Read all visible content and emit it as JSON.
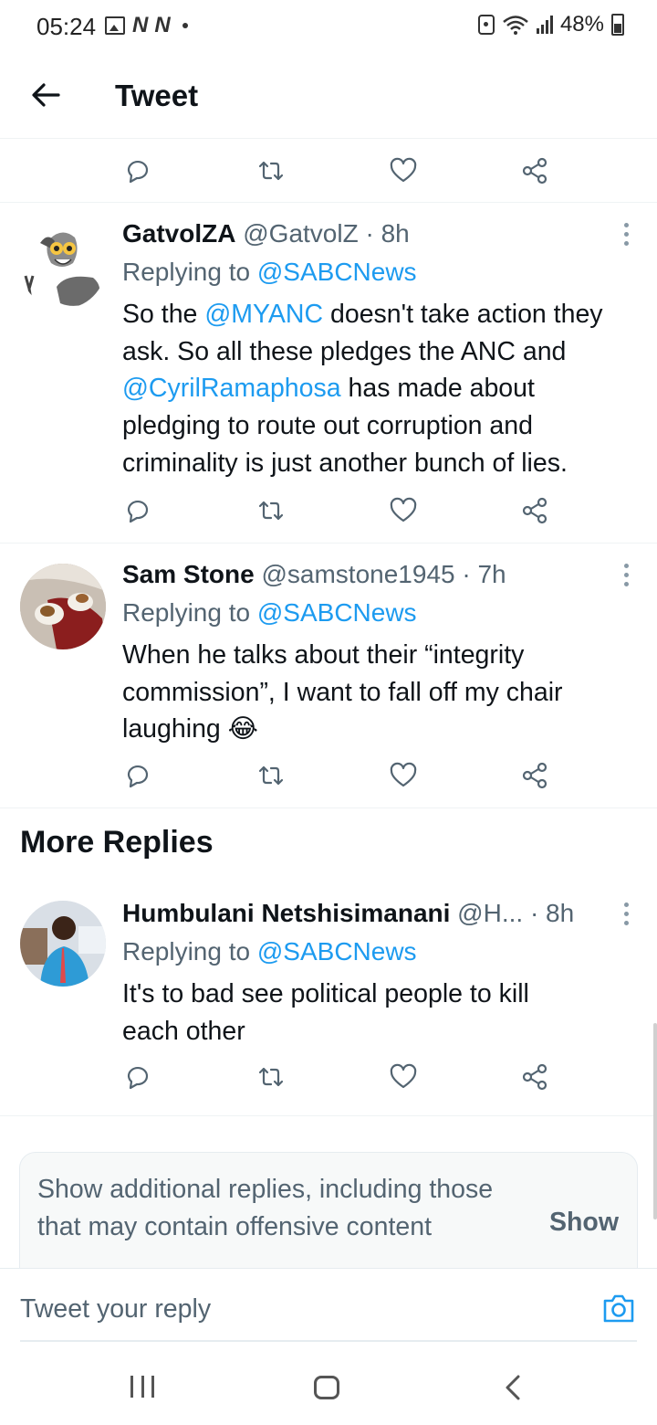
{
  "status_bar": {
    "time": "05:24",
    "notif_n1": "N",
    "notif_n2": "N",
    "battery": "48%"
  },
  "header": {
    "title": "Tweet"
  },
  "tweets": [
    {
      "name": "GatvolZA",
      "meta": " @GatvolZ · 8h",
      "reply_prefix": "Replying to ",
      "reply_to": "@SABCNews",
      "body": [
        {
          "text": "So the "
        },
        {
          "text": "@MYANC",
          "link": true
        },
        {
          "text": " doesn't take action they ask. So all these pledges the ANC and "
        },
        {
          "text": "@CyrilRamaphosa",
          "link": true
        },
        {
          "text": " has made about pledging to route out corruption and criminality is just another bunch of lies."
        }
      ]
    },
    {
      "name": "Sam Stone",
      "meta": " @samstone1945 · 7h",
      "reply_prefix": "Replying to ",
      "reply_to": "@SABCNews",
      "body": [
        {
          "text": "When he talks about their “integrity commission”, I want to fall off my chair laughing 😂"
        }
      ]
    },
    {
      "name": "Humbulani Netshisimanani",
      "meta": " @H...  · 8h",
      "reply_prefix": "Replying to ",
      "reply_to": "@SABCNews",
      "body": [
        {
          "text": "It's to bad  see political people to kill each other"
        }
      ]
    }
  ],
  "more_replies": {
    "title": "More Replies"
  },
  "additional": {
    "text": "Show additional replies, including those that may contain offensive content",
    "show_label": "Show"
  },
  "composer": {
    "placeholder": "Tweet your reply"
  },
  "icons": {
    "reply": "reply-icon",
    "retweet": "retweet-icon",
    "like": "heart-icon",
    "share": "share-icon"
  },
  "colors": {
    "link": "#1d9bf0",
    "secondary_text": "#536471",
    "icon": "#536471"
  }
}
